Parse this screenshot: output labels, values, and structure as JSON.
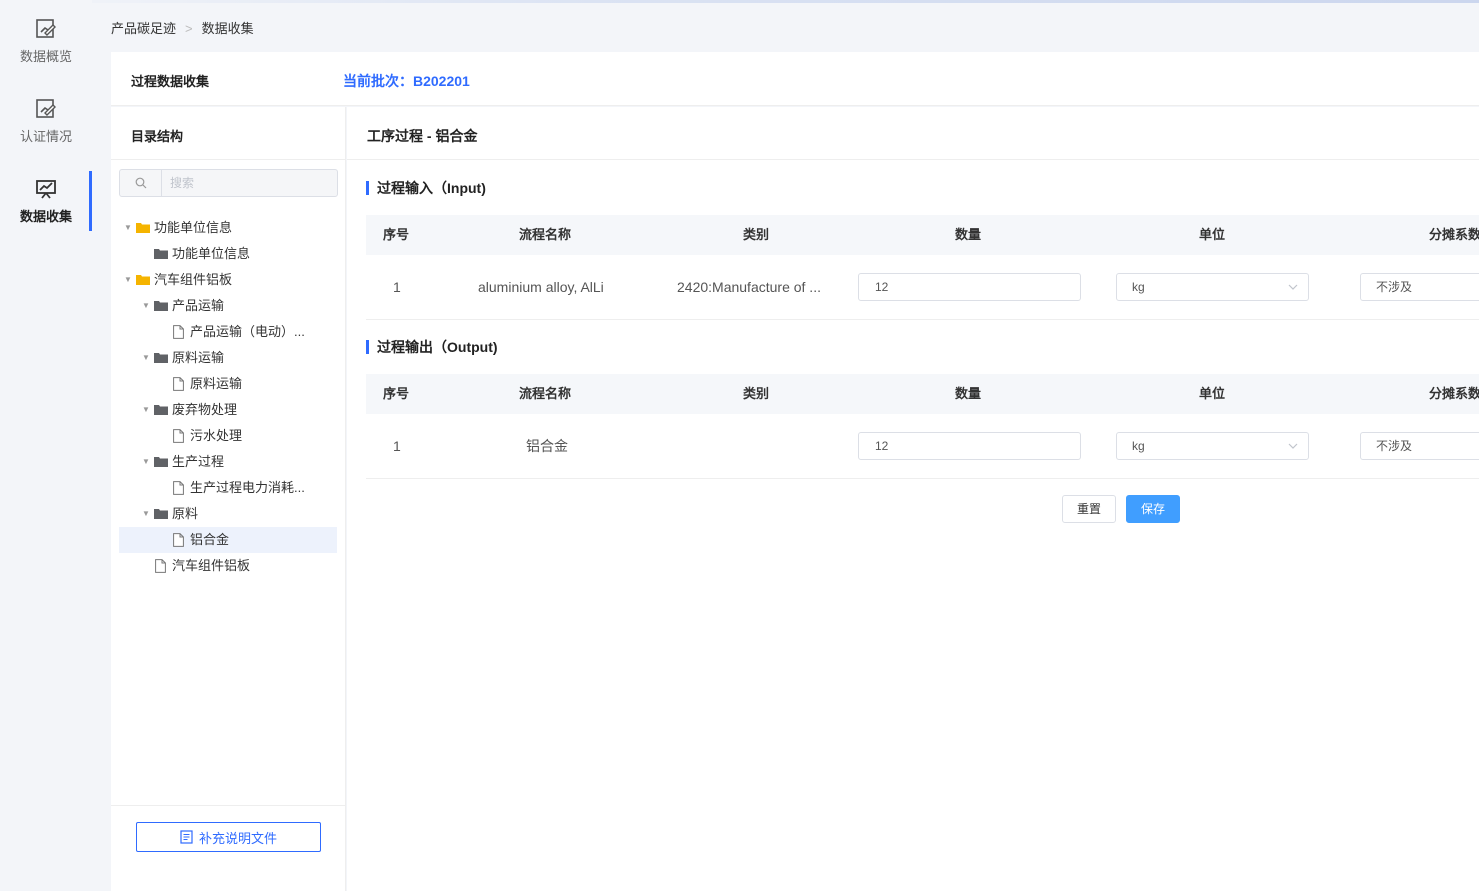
{
  "rail": [
    {
      "icon": "edit-chart-icon",
      "label": "数据概览",
      "active": false
    },
    {
      "icon": "edit-chart-icon",
      "label": "认证情况",
      "active": false
    },
    {
      "icon": "presentation-chart-icon",
      "label": "数据收集",
      "active": true
    }
  ],
  "breadcrumb": {
    "root": "产品碳足迹",
    "current": "数据收集"
  },
  "header": {
    "title": "过程数据收集",
    "batch": "当前批次：B202201"
  },
  "tree_panel": {
    "title": "目录结构",
    "search_placeholder": "搜索",
    "nodes": [
      {
        "label": "功能单位信息",
        "level": 0,
        "type": "folder-open",
        "arrow": true,
        "selected": false
      },
      {
        "label": "功能单位信息",
        "level": 1,
        "type": "folder",
        "arrow": false,
        "selected": false
      },
      {
        "label": "汽车组件铝板",
        "level": 0,
        "type": "folder-open",
        "arrow": true,
        "selected": false
      },
      {
        "label": "产品运输",
        "level": 1,
        "type": "folder",
        "arrow": true,
        "selected": false
      },
      {
        "label": "产品运输（电动）...",
        "level": 2,
        "type": "file",
        "arrow": false,
        "selected": false
      },
      {
        "label": "原料运输",
        "level": 1,
        "type": "folder",
        "arrow": true,
        "selected": false
      },
      {
        "label": "原料运输",
        "level": 2,
        "type": "file",
        "arrow": false,
        "selected": false
      },
      {
        "label": "废弃物处理",
        "level": 1,
        "type": "folder",
        "arrow": true,
        "selected": false
      },
      {
        "label": "污水处理",
        "level": 2,
        "type": "file",
        "arrow": false,
        "selected": false
      },
      {
        "label": "生产过程",
        "level": 1,
        "type": "folder",
        "arrow": true,
        "selected": false
      },
      {
        "label": "生产过程电力消耗...",
        "level": 2,
        "type": "file",
        "arrow": false,
        "selected": false
      },
      {
        "label": "原料",
        "level": 1,
        "type": "folder",
        "arrow": true,
        "selected": false
      },
      {
        "label": "铝合金",
        "level": 2,
        "type": "file",
        "arrow": false,
        "selected": true
      },
      {
        "label": "汽车组件铝板",
        "level": 1,
        "type": "file",
        "arrow": false,
        "selected": false
      }
    ],
    "supplement_button": "补充说明文件"
  },
  "main": {
    "title": "工序过程 - 铝合金",
    "columns": [
      "序号",
      "流程名称",
      "类别",
      "数量",
      "单位",
      "分摊系数"
    ],
    "input": {
      "title": "过程输入（Input)",
      "rows": [
        {
          "index": "1",
          "name": "aluminium alloy, AlLi",
          "category": "2420:Manufacture of ...",
          "quantity": "12",
          "unit": "kg",
          "allocation": "不涉及"
        }
      ]
    },
    "output": {
      "title": "过程输出（Output)",
      "rows": [
        {
          "index": "1",
          "name": "铝合金",
          "category": "",
          "quantity": "12",
          "unit": "kg",
          "allocation": "不涉及"
        }
      ]
    },
    "reset_button": "重置",
    "save_button": "保存"
  },
  "colors": {
    "accent": "#2f6bff",
    "save": "#409eff",
    "selected_row": "#edf2fc"
  }
}
